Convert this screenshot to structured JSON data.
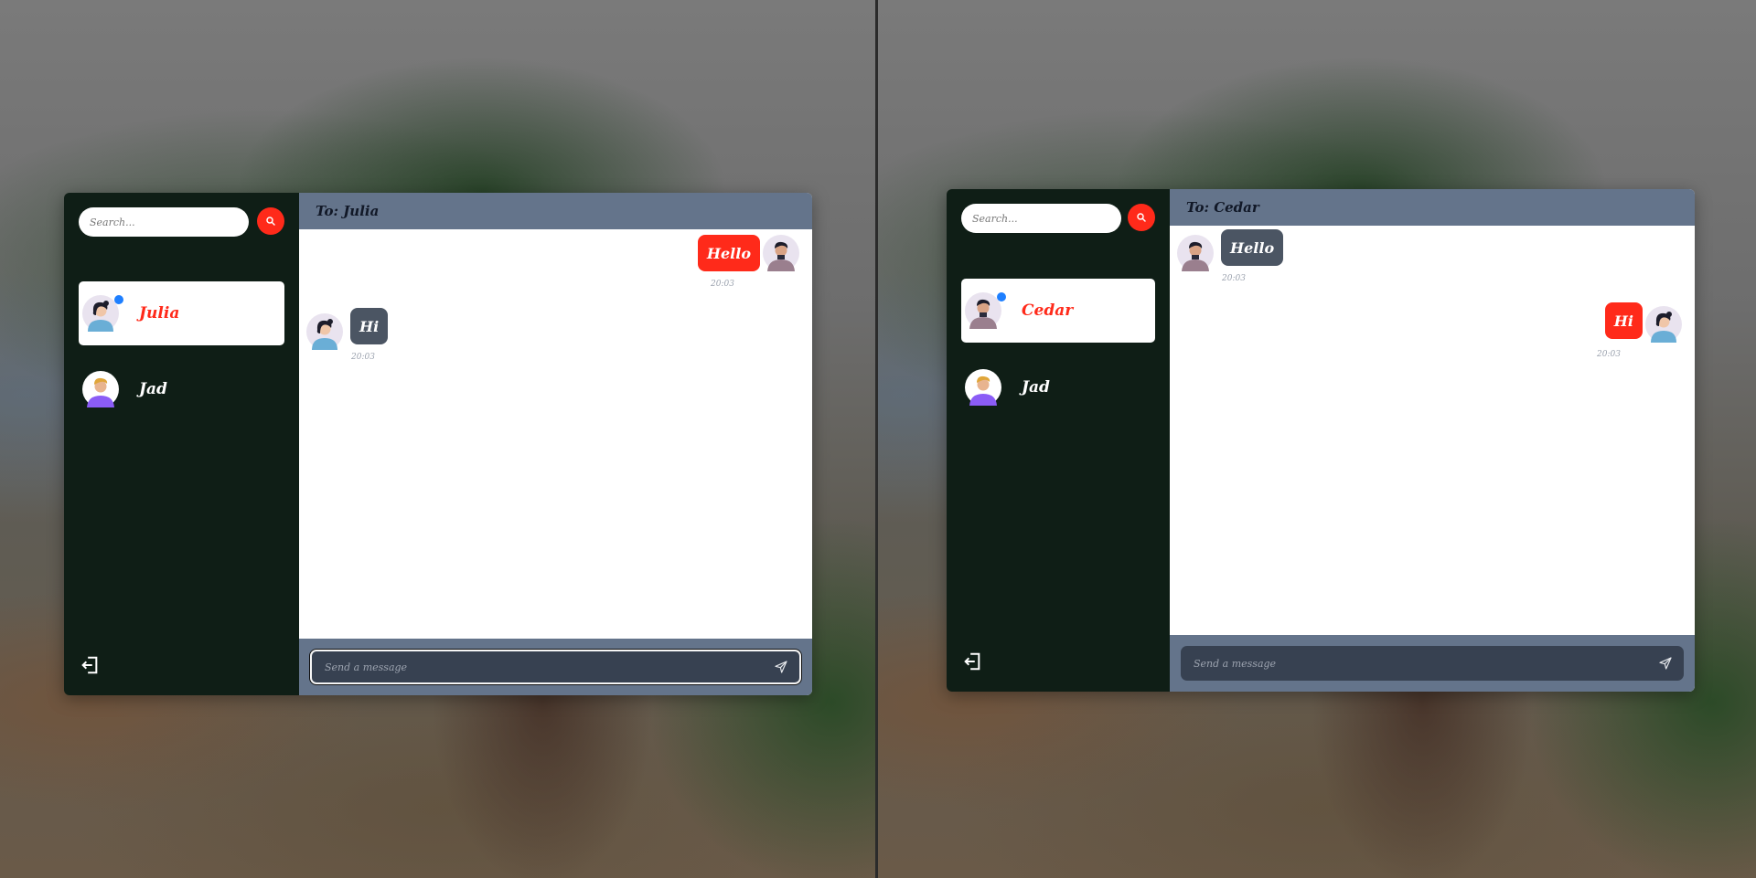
{
  "colors": {
    "accent": "#ff2a1a",
    "sidebar": "#0f1e16",
    "header": "#64748b",
    "online": "#1e7fff"
  },
  "panes": [
    {
      "search": {
        "placeholder": "Search..."
      },
      "contacts": [
        {
          "name": "Julia",
          "avatar": "woman-avatar",
          "active": true,
          "online": true
        },
        {
          "name": "Jad",
          "avatar": "boy-avatar",
          "active": false,
          "online": false
        }
      ],
      "header": {
        "title": "To: Julia"
      },
      "messages": [
        {
          "text": "Hello",
          "time": "20:03",
          "side": "right"
        },
        {
          "text": "Hi",
          "time": "20:03",
          "side": "left"
        }
      ],
      "composer": {
        "placeholder": "Send a message"
      }
    },
    {
      "search": {
        "placeholder": "Search..."
      },
      "contacts": [
        {
          "name": "Cedar",
          "avatar": "man-avatar",
          "active": true,
          "online": true
        },
        {
          "name": "Jad",
          "avatar": "boy-avatar",
          "active": false,
          "online": false
        }
      ],
      "header": {
        "title": "To: Cedar"
      },
      "messages": [
        {
          "text": "Hello",
          "time": "20:03",
          "side": "left"
        },
        {
          "text": "Hi",
          "time": "20:03",
          "side": "right"
        }
      ],
      "composer": {
        "placeholder": "Send a message"
      }
    }
  ]
}
